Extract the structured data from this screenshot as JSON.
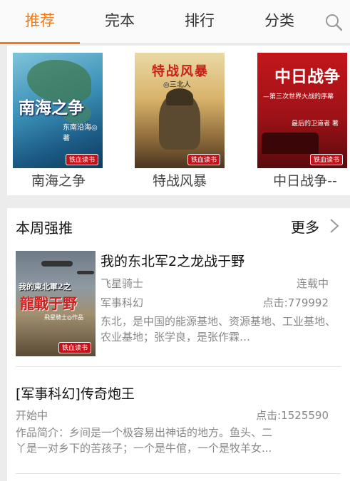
{
  "tabs": [
    {
      "label": "推荐",
      "active": true
    },
    {
      "label": "完本",
      "active": false
    },
    {
      "label": "排行",
      "active": false
    },
    {
      "label": "分类",
      "active": false
    }
  ],
  "search_icon": "search-icon",
  "accent_color": "#f07a1a",
  "shelf": [
    {
      "title": "南海之争",
      "cover_text": "南海之争",
      "cover_author": "东南沿海◎著",
      "cover_badge": "铁血读书"
    },
    {
      "title": "特战风暴",
      "cover_text": "特战风暴",
      "cover_author": "◎三北人",
      "cover_badge": "铁血读书"
    },
    {
      "title": "中日战争--",
      "cover_text": "中日战争",
      "cover_sub": "—第三次世界大战的序幕",
      "cover_author": "最后的卫道者 著",
      "cover_badge": "铁血读书"
    }
  ],
  "weekly": {
    "title": "本周强推",
    "more_label": "更多",
    "items": [
      {
        "title": "我的东北军2之龙战于野",
        "author": "飞星骑士",
        "status": "连载中",
        "category": "军事科幻",
        "clicks": "点击:779992",
        "description": "东北，是中国的能源基地、资源基地、工业基地、农业基地；张学良，是张作霖…",
        "cover_text_top": "我的東北軍2之",
        "cover_text_main": "龍戰于野",
        "cover_author": "飛星騎士◎作品",
        "cover_badge": "铁血读书"
      },
      {
        "title": "[军事科幻]传奇炮王",
        "status": "开始中",
        "clicks": "点击:1525590",
        "description_line1": "作品简介：乡间是一个极容易出神话的地方。鱼头、二",
        "description_line2": "丫是一对乡下的苦孩子；一个是牛倌，一个是牧羊女..."
      }
    ]
  }
}
